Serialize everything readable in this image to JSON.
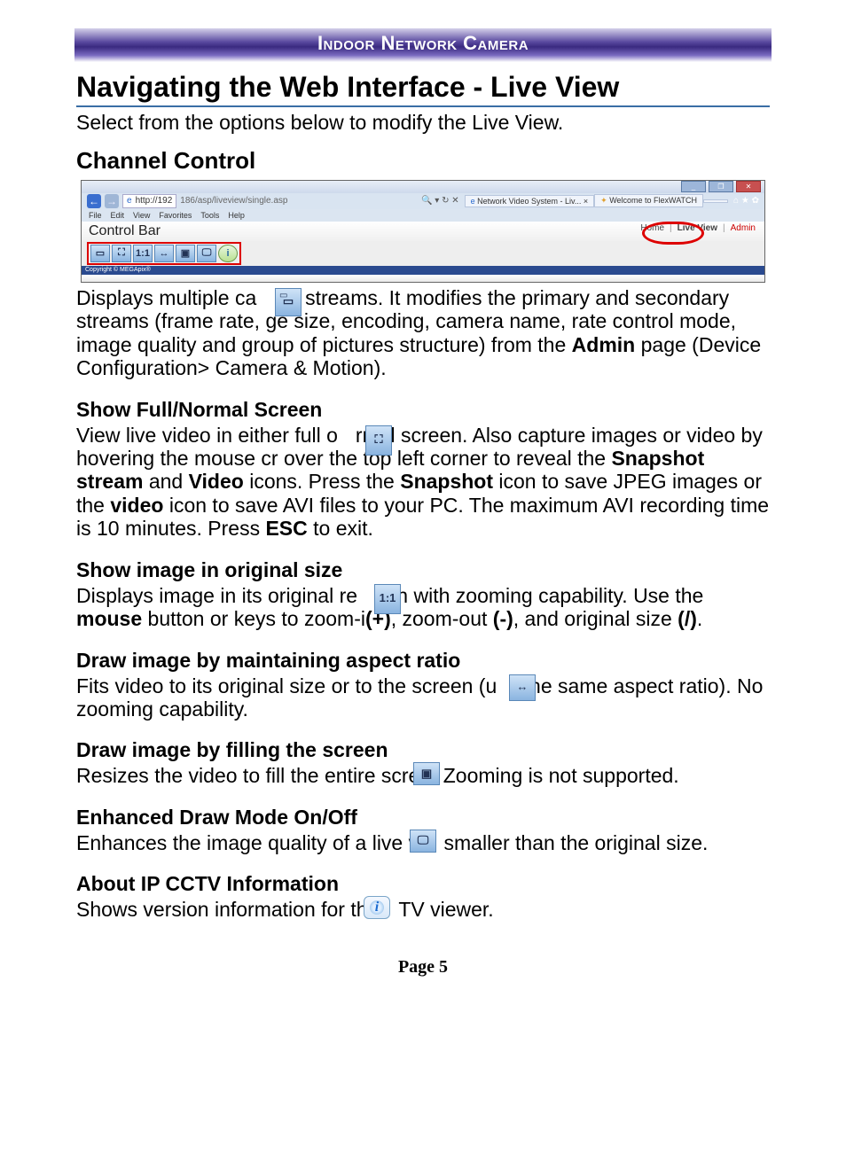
{
  "banner": "Indoor Network Camera",
  "title": "Navigating the Web Interface - Live View",
  "intro": "Select from the options below to modify the Live View.",
  "channel_control": {
    "heading": "Channel Control",
    "body_pre": "Displays multiple ca",
    "body_mid1": "ra streams. It modifies the primary and secondary streams (frame rate, ",
    "body_mid2": "ge size, encoding, camera name, rate control mode, image quality and group of pictures structure) from the ",
    "admin": "Admin",
    "body_end": " page (Device Configuration> Camera & Motion)."
  },
  "full_normal": {
    "heading": "Show Full/Normal Screen",
    "p1a": "View live video in either full o",
    "p1b": "rmal screen. Also capture images or video by hovering the mouse c",
    "p1c": "r over the top left corner to reveal the ",
    "snapshot_stream": "Snapshot stream",
    "and": " and ",
    "video_b": "Video",
    "p2a": " icons. Press the ",
    "snapshot": "Snapshot",
    "p2b": " icon to save JPEG images or the ",
    "video_b2": "video",
    "p2c": " icon to save AVI files to your PC. The maximum AVI recording time is 10 minutes. Press ",
    "esc": "ESC",
    "p2d": " to exit."
  },
  "orig_size": {
    "heading": "Show image in original size",
    "p1a": "Displays image in its original re",
    "p1b": "tion with zooming capability. Use the ",
    "mouse": "mouse",
    "p2a": " button or keys to zoom-i",
    "plus": "(+)",
    "p2b": ", zoom-out ",
    "minus": "(-)",
    "p2c": ", and original size ",
    "slash": "(/)",
    "p2d": "."
  },
  "aspect": {
    "heading": "Draw image by maintaining aspect ratio",
    "p1a": "Fits video to its original size or to the screen (u",
    "p1b": " the same aspect ratio). No zooming capability."
  },
  "fill": {
    "heading": "Draw image by filling the screen",
    "p1a": "Resizes the video to fill the entire scre",
    "p1b": " Zooming is not supported."
  },
  "enhanced": {
    "heading": "Enhanced Draw Mode On/Off",
    "p1a": "Enhances the image quality of a live v",
    "p1b": " smaller than the original size."
  },
  "about": {
    "heading": "About IP CCTV Information",
    "p1a": "Shows version information for the",
    "p1b": "TV viewer."
  },
  "page_label": "Page 5",
  "screenshot": {
    "win": {
      "min": "_",
      "max": "❐",
      "close": "✕"
    },
    "back_glyph": "←",
    "fwd_glyph": "→",
    "url_text": "http://192",
    "url_path": "186/asp/liveview/single.asp",
    "search_glyph": "🔍 ▾ ↻ ✕",
    "tab1": "Network Video System - Liv... ×",
    "tab2": "Welcome to FlexWATCH",
    "star_icons": "⌂ ★ ✿",
    "menu": [
      "File",
      "Edit",
      "View",
      "Favorites",
      "Tools",
      "Help"
    ],
    "control_bar": "Control Bar",
    "nav": {
      "home": "Home",
      "live": "Live View",
      "admin": "Admin"
    },
    "footer": "Copyright © MEGApix®"
  }
}
